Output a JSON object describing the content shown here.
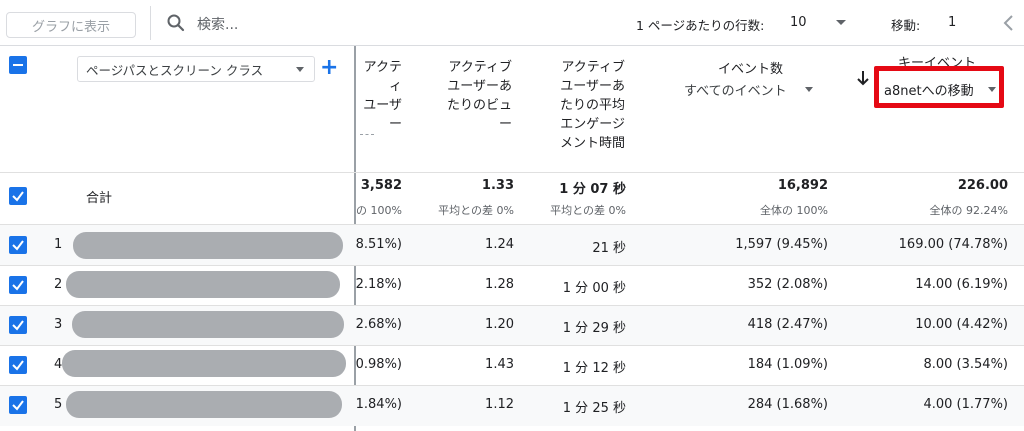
{
  "toolbar": {
    "graph_button": "グラフに表示",
    "search_placeholder": "検索...",
    "rows_label": "1 ページあたりの行数:",
    "rows_value": "10",
    "goto_label": "移動:",
    "goto_value": "1"
  },
  "dimension": {
    "select_label": "ページパスとスクリーン クラス",
    "add_symbol": "+"
  },
  "columns": {
    "col1": [
      "アクティ",
      "ユーザ",
      "ー"
    ],
    "col2": [
      "アクティブ",
      "ユーザーあ",
      "たりのビュ",
      "ー"
    ],
    "col3": [
      "アクティブ",
      "ユーザーあ",
      "たりの平均",
      "エンゲージ",
      "メント時間"
    ],
    "event_title": "イベント数",
    "event_select": "すべてのイベント",
    "key_title": "キーイベント",
    "key_select": "a8netへの移動"
  },
  "totals": {
    "label": "合計",
    "c1": "3,582",
    "c1_sub": "の 100%",
    "c2": "1.33",
    "c2_sub": "平均との差 0%",
    "c3": "1 分 07 秒",
    "c3_sub": "平均との差 0%",
    "c4": "16,892",
    "c4_sub": "全体の 100%",
    "c5": "226.00",
    "c5_sub": "全体の 92.24%"
  },
  "rows": [
    {
      "n": "1",
      "c1": "8.51%)",
      "c2": "1.24",
      "c3": "21 秒",
      "c4": "1,597 (9.45%)",
      "c5": "169.00 (74.78%)"
    },
    {
      "n": "2",
      "c1": "2.18%)",
      "c2": "1.28",
      "c3": "1 分 00 秒",
      "c4": "352 (2.08%)",
      "c5": "14.00 (6.19%)"
    },
    {
      "n": "3",
      "c1": "2.68%)",
      "c2": "1.20",
      "c3": "1 分 29 秒",
      "c4": "418 (2.47%)",
      "c5": "10.00 (4.42%)"
    },
    {
      "n": "4",
      "c1": "0.98%)",
      "c2": "1.43",
      "c3": "1 分 12 秒",
      "c4": "184 (1.09%)",
      "c5": "8.00 (3.54%)"
    },
    {
      "n": "5",
      "c1": "1.84%)",
      "c2": "1.12",
      "c3": "1 分 25 秒",
      "c4": "284 (1.68%)",
      "c5": "4.00 (1.77%)"
    }
  ],
  "colors": {
    "accent": "#1a73e8",
    "highlight": "#e50914"
  }
}
